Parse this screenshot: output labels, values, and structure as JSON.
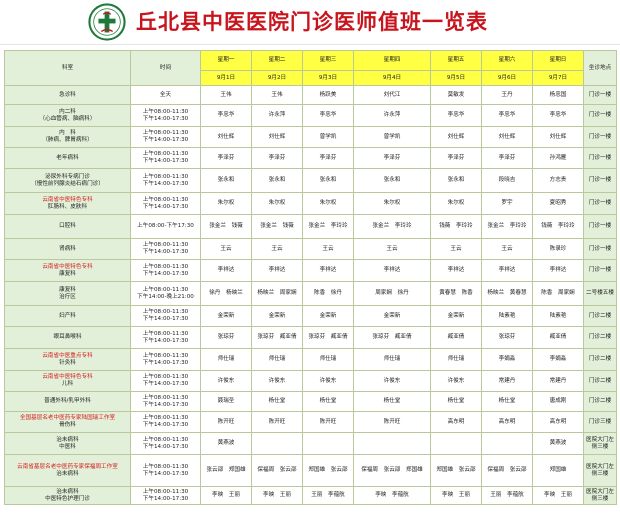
{
  "title": "丘北县中医医院门诊医师值班一览表",
  "header": {
    "dept_label": "科室",
    "time_label": "时间",
    "loc_label": "坐诊地点",
    "weekdays": [
      "星期一",
      "星期二",
      "星期三",
      "星期四",
      "星期五",
      "星期六",
      "星期日"
    ],
    "dates": [
      "9月1日",
      "9月2日",
      "9月3日",
      "9月4日",
      "9月5日",
      "9月6日",
      "9月7日"
    ]
  },
  "rows": [
    {
      "dept": [
        "急诊科"
      ],
      "dept_red": [
        false
      ],
      "time": [
        "全天"
      ],
      "cells": [
        "王伟",
        "王伟",
        "杨跃美",
        "刘代江",
        "莫敏发",
        "王丹",
        "杨忠国"
      ],
      "loc": "门诊一楼"
    },
    {
      "dept": [
        "内二科",
        "（心血管病、脑病科）"
      ],
      "dept_red": [
        false,
        false
      ],
      "time": [
        "上午08:00-11:30",
        "下午14:00-17:30"
      ],
      "cells": [
        "李忠华",
        "许永萍",
        "李忠华",
        "许永萍",
        "李忠华",
        "李忠华",
        "李忠华"
      ],
      "loc": "门诊一楼"
    },
    {
      "dept": [
        "内　科",
        "（肺病、脾胃病科）"
      ],
      "dept_red": [
        false,
        false
      ],
      "time": [
        "上午08:00-11:30",
        "下午14:00-17:30"
      ],
      "cells": [
        "刘仕辉",
        "刘仕辉",
        "曾学凯",
        "曾学凯",
        "刘仕辉",
        "刘仕辉",
        "刘仕辉"
      ],
      "loc": "门诊一楼"
    },
    {
      "dept": [
        "老年病科"
      ],
      "dept_red": [
        false
      ],
      "time": [
        "上午08:00-11:30",
        "下午14:00-17:30"
      ],
      "cells": [
        "李泽芬",
        "李泽芬",
        "李泽芬",
        "李泽芬",
        "李泽芬",
        "李泽芬",
        "孙鸿雁"
      ],
      "loc": "门诊一楼"
    },
    {
      "dept": [
        "泌尿外科专病门诊",
        "（慢性前列腺炎结石病门诊）"
      ],
      "dept_red": [
        false,
        false
      ],
      "time": [
        "上午08:00-11:30",
        "下午14:00-17:30"
      ],
      "cells": [
        "张永和",
        "张永和",
        "张永和",
        "张永和",
        "张永和",
        "段晓吉",
        "方志贵"
      ],
      "loc": "门诊一楼"
    },
    {
      "dept": [
        "云南省中医特色专科",
        "肛肠科、皮肤科"
      ],
      "dept_red": [
        true,
        false
      ],
      "time": [
        "上午08:00-11:30",
        "下午14:00-17:30"
      ],
      "cells": [
        "朱尔权",
        "朱尔权",
        "朱尔权",
        "朱尔权",
        "朱尔权",
        "罗宇",
        "夏昭秀"
      ],
      "loc": "门诊一楼"
    },
    {
      "dept": [
        "口腔科"
      ],
      "dept_red": [
        false
      ],
      "time": [
        "上午08:00-下午17:30"
      ],
      "cells": [
        "张金兰　钱薇",
        "张金兰　钱薇",
        "张金兰　李玲玲",
        "张金兰　李玲玲",
        "钱薇　李玲玲",
        "张金兰　李玲玲",
        "钱薇　李玲玲"
      ],
      "loc": "门诊一楼"
    },
    {
      "dept": [
        "肾病科"
      ],
      "dept_red": [
        false
      ],
      "time": [
        "上午08:00-11:30",
        "下午14:00-17:30"
      ],
      "cells": [
        "王云",
        "王云",
        "王云",
        "王云",
        "王云",
        "王云",
        "陈录珍"
      ],
      "loc": "门诊一楼"
    },
    {
      "dept": [
        "云南省中医特色专科",
        "康复科"
      ],
      "dept_red": [
        true,
        false
      ],
      "time": [
        "上午08:00-11:30",
        "下午14:00-17:30"
      ],
      "cells": [
        "李祥达",
        "李祥达",
        "李祥达",
        "李祥达",
        "李祥达",
        "李祥达",
        "李祥达"
      ],
      "loc": "门诊一楼"
    },
    {
      "dept": [
        "康复科",
        "治疗区"
      ],
      "dept_red": [
        false,
        false
      ],
      "time": [
        "上午08:00-11:30",
        "下午14:00-晚上21:00"
      ],
      "cells": [
        "徐丹　杨映兰",
        "杨映兰　周家娴",
        "陈香　徐丹",
        "周家娴　徐丹",
        "黄春慧　陈香",
        "杨映兰　黄春慧",
        "陈香　周家娴"
      ],
      "loc": "二号楼五楼"
    },
    {
      "dept": [
        "妇产科"
      ],
      "dept_red": [
        false
      ],
      "time": [
        "上午08:00-11:30",
        "下午14:00-17:30"
      ],
      "cells": [
        "金荣新",
        "金荣新",
        "金荣新",
        "金荣新",
        "金荣新",
        "陆素艳",
        "陆素艳"
      ],
      "loc": "门诊二楼"
    },
    {
      "dept": [
        "眼耳鼻喉科"
      ],
      "dept_red": [
        false
      ],
      "time": [
        "上午08:00-11:30",
        "下午14:00-17:30"
      ],
      "cells": [
        "张琼芬",
        "张琼芬　臧亚倩",
        "张琼芬　臧亚倩",
        "张琼芬　臧亚倩",
        "臧亚倩",
        "张琼芬",
        "臧亚倩"
      ],
      "loc": "门诊二楼"
    },
    {
      "dept": [
        "云南省中医重点专科",
        "针灸科"
      ],
      "dept_red": [
        true,
        false
      ],
      "time": [
        "上午08:00-11:30",
        "下午14:00-17:30"
      ],
      "cells": [
        "师仕瑞",
        "师仕瑞",
        "师仕瑞",
        "师仕瑞",
        "师仕瑞",
        "李娟淼",
        "李娟淼"
      ],
      "loc": "门诊二楼"
    },
    {
      "dept": [
        "云南省中医特色专科",
        "儿科"
      ],
      "dept_red": [
        true,
        false
      ],
      "time": [
        "上午08:00-11:30",
        "下午14:00-17:30"
      ],
      "cells": [
        "许俊东",
        "许俊东",
        "许俊东",
        "许俊东",
        "许俊东",
        "常建丹",
        "常建丹"
      ],
      "loc": "门诊二楼"
    },
    {
      "dept": [
        "普通外科/乳甲外科"
      ],
      "dept_red": [
        false
      ],
      "time": [
        "上午08:00-11:30",
        "下午14:00-17:30"
      ],
      "cells": [
        "聂瑞圣",
        "杨仕堂",
        "杨仕堂",
        "杨仕堂",
        "杨仕堂",
        "杨仕堂",
        "唐成刚"
      ],
      "loc": "门诊二楼"
    },
    {
      "dept": [
        "全国基层名老中医药专家陆国瑞工作室",
        "骨伤科"
      ],
      "dept_red": [
        true,
        false
      ],
      "time": [
        "上午08:00-11:30",
        "下午14:00-17:30"
      ],
      "cells": [
        "陈开旺",
        "陈开旺",
        "陈开旺",
        "陈开旺",
        "高东明",
        "高东明",
        "高东明"
      ],
      "loc": "门诊三楼"
    },
    {
      "dept": [
        "治未病科",
        "中医科"
      ],
      "dept_red": [
        false,
        false
      ],
      "time": [
        "上午08:00-11:30",
        "下午14:00-17:30"
      ],
      "cells": [
        "黄燕波",
        "",
        "",
        "",
        "",
        "",
        "黄燕波"
      ],
      "loc": "医院大门左侧三楼"
    },
    {
      "dept": [
        "云南省基层名老中医药专家保福周工作室",
        "治未病科"
      ],
      "dept_red": [
        true,
        false
      ],
      "time": [
        "上午08:00-11:30",
        "下午14:00-17:30"
      ],
      "cells": [
        "张云邵　郑国雄",
        "保福周　张云邵",
        "郑国雄　张云邵",
        "保福周　张云邵　郑国雄",
        "郑国雄　张云邵",
        "保福周　张云邵",
        "郑国雄"
      ],
      "loc": "医院大门左侧三楼"
    },
    {
      "dept": [
        "治未病科",
        "中医特色护理门诊"
      ],
      "dept_red": [
        false,
        false
      ],
      "time": [
        "上午08:00-11:30",
        "下午14:00-17:30"
      ],
      "cells": [
        "李映　王丽",
        "李映　王丽",
        "王丽　李蕴航",
        "李映　李蕴航",
        "李映　王丽",
        "王丽　李蕴航",
        "李映　王丽"
      ],
      "loc": "医院大门左侧三楼"
    }
  ]
}
